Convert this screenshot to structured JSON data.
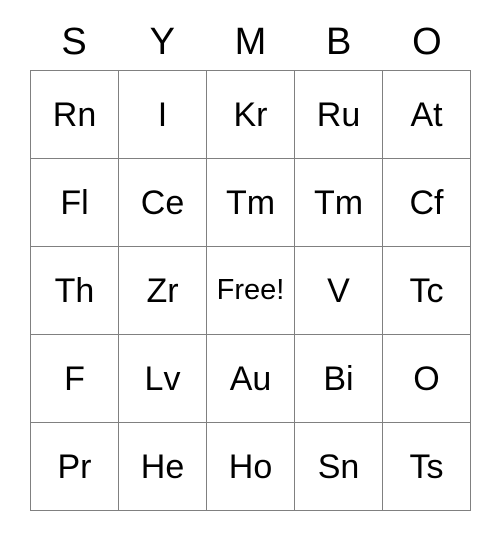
{
  "card": {
    "header": {
      "letters": [
        "S",
        "Y",
        "M",
        "B",
        "O"
      ]
    },
    "grid": {
      "rows": [
        {
          "cells": [
            {
              "label": "Rn",
              "free": false
            },
            {
              "label": "I",
              "free": false
            },
            {
              "label": "Kr",
              "free": false
            },
            {
              "label": "Ru",
              "free": false
            },
            {
              "label": "At",
              "free": false
            }
          ]
        },
        {
          "cells": [
            {
              "label": "Fl",
              "free": false
            },
            {
              "label": "Ce",
              "free": false
            },
            {
              "label": "Tm",
              "free": false
            },
            {
              "label": "Tm",
              "free": false
            },
            {
              "label": "Cf",
              "free": false
            }
          ]
        },
        {
          "cells": [
            {
              "label": "Th",
              "free": false
            },
            {
              "label": "Zr",
              "free": false
            },
            {
              "label": "Free!",
              "free": true
            },
            {
              "label": "V",
              "free": false
            },
            {
              "label": "Tc",
              "free": false
            }
          ]
        },
        {
          "cells": [
            {
              "label": "F",
              "free": false
            },
            {
              "label": "Lv",
              "free": false
            },
            {
              "label": "Au",
              "free": false
            },
            {
              "label": "Bi",
              "free": false
            },
            {
              "label": "O",
              "free": false
            }
          ]
        },
        {
          "cells": [
            {
              "label": "Pr",
              "free": false
            },
            {
              "label": "He",
              "free": false
            },
            {
              "label": "Ho",
              "free": false
            },
            {
              "label": "Sn",
              "free": false
            },
            {
              "label": "Ts",
              "free": false
            }
          ]
        }
      ]
    },
    "colors": {
      "border": "#808080",
      "text": "#000000",
      "background": "#ffffff"
    }
  }
}
